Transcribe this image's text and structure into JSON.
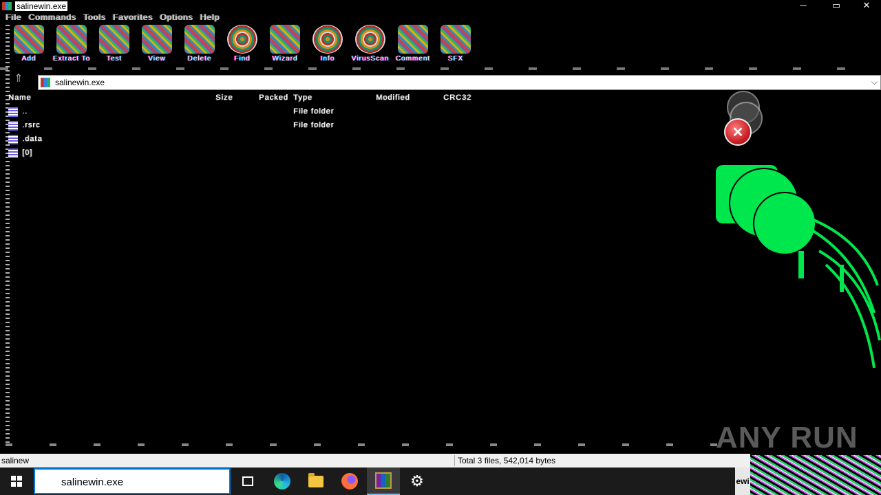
{
  "window": {
    "title": "salinewin.exe",
    "menu_items": [
      "File",
      "Commands",
      "Tools",
      "Favorites",
      "Options",
      "Help"
    ]
  },
  "toolbar": {
    "buttons": [
      {
        "label": "Add",
        "icon": "add-icon"
      },
      {
        "label": "Extract To",
        "icon": "extract-icon"
      },
      {
        "label": "Test",
        "icon": "test-icon"
      },
      {
        "label": "View",
        "icon": "view-icon"
      },
      {
        "label": "Delete",
        "icon": "delete-icon"
      },
      {
        "label": "Find",
        "icon": "find-icon"
      },
      {
        "label": "Wizard",
        "icon": "wizard-icon"
      },
      {
        "label": "Info",
        "icon": "info-icon"
      },
      {
        "label": "VirusScan",
        "icon": "virus-scan-icon"
      },
      {
        "label": "Comment",
        "icon": "comment-icon"
      },
      {
        "label": "SFX",
        "icon": "sfx-icon"
      }
    ]
  },
  "address": {
    "path": "salinewin.exe"
  },
  "file_list": {
    "columns": [
      "Name",
      "Size",
      "Packed",
      "Type",
      "Modified",
      "CRC32"
    ],
    "parent_row": "..",
    "parent_type": "File folder",
    "rows": [
      {
        "name": ".rsrc",
        "size": "",
        "packed": "",
        "type": "File folder",
        "modified": "",
        "crc": ""
      },
      {
        "name": ".data",
        "size": "",
        "packed": "",
        "type": "",
        "modified": "",
        "crc": ""
      },
      {
        "name": "[0]",
        "size": "",
        "packed": "",
        "type": "",
        "modified": "",
        "crc": ""
      }
    ]
  },
  "status": {
    "left": "salinew",
    "right": "Total 3 files, 542,014 bytes"
  },
  "watermark": "ANY RUN",
  "taskbar": {
    "search_text": "salinewin.exe",
    "tray_label": "ewi"
  },
  "colors": {
    "background": "#000000",
    "glitch_green": "#00e64d",
    "error_red": "#c0151b",
    "taskbar": "#1b1b1b"
  }
}
